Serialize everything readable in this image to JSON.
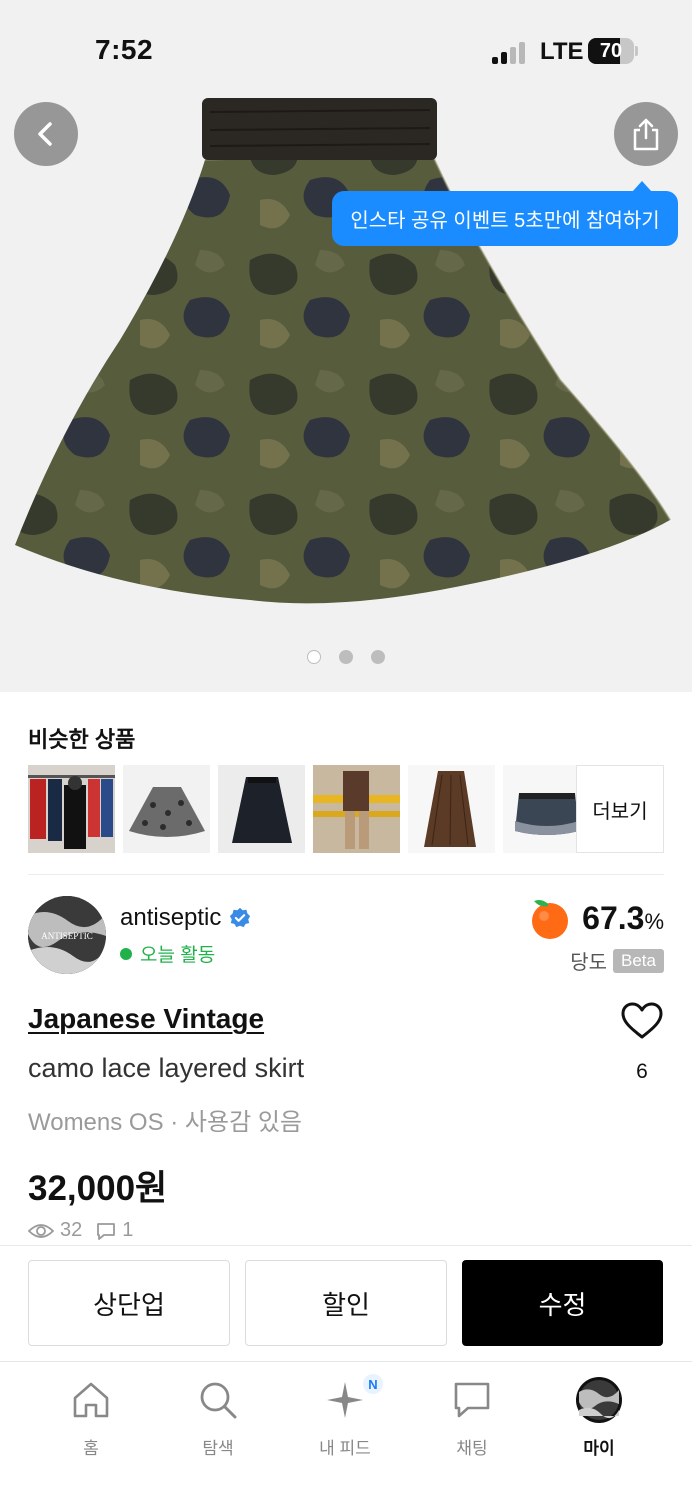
{
  "status_bar": {
    "time": "7:52",
    "network": "LTE",
    "battery": "70"
  },
  "hero": {
    "tooltip": "인스타 공유 이벤트 5초만에 참여하기",
    "image_count": 3,
    "current_image": 1
  },
  "similar": {
    "title": "비슷한 상품",
    "more": "더보기",
    "thumbnails": [
      "clothing-rack",
      "leopard-skirt",
      "black-skirt",
      "street-photo",
      "brown-pleated-skirt",
      "denim-skirt"
    ]
  },
  "seller": {
    "name": "antiseptic",
    "activity": "오늘 활동",
    "sweetness_value": "67.3",
    "sweetness_unit": "%",
    "sweetness_label": "당도",
    "beta": "Beta"
  },
  "product": {
    "brand": "Japanese Vintage",
    "title": "camo lace layered skirt",
    "meta": "Womens OS · 사용감 있음",
    "price": "32,000원",
    "views": "32",
    "comments": "1",
    "likes": "6"
  },
  "actions": {
    "bump": "상단업",
    "discount": "할인",
    "edit": "수정"
  },
  "tabs": [
    {
      "label": "홈",
      "icon": "home-icon"
    },
    {
      "label": "탐색",
      "icon": "search-icon"
    },
    {
      "label": "내 피드",
      "icon": "sparkle-icon",
      "badge": "N"
    },
    {
      "label": "채팅",
      "icon": "chat-icon"
    },
    {
      "label": "마이",
      "icon": "avatar-icon"
    }
  ],
  "colors": {
    "accent": "#1a8cff",
    "active_green": "#20b14b",
    "primary_button": "#000000"
  }
}
